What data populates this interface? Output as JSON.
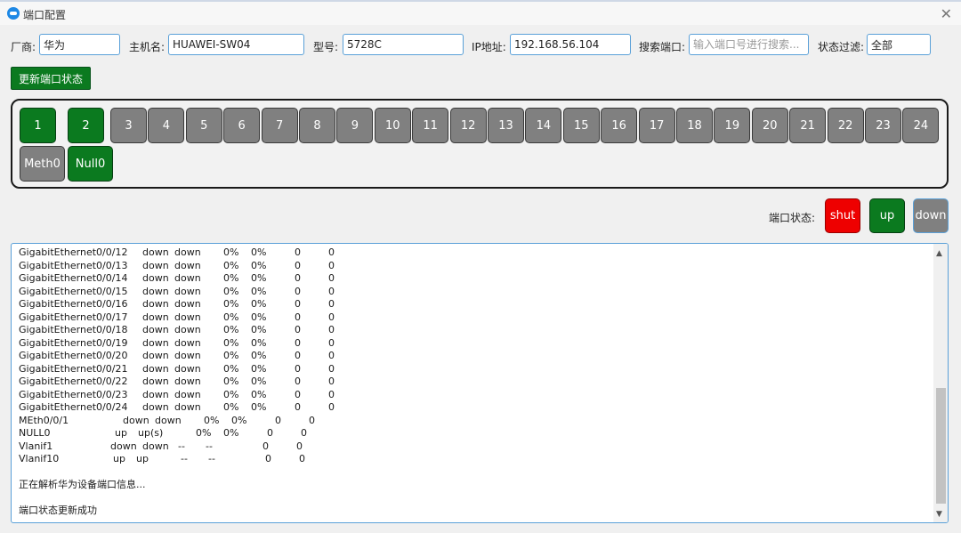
{
  "window": {
    "title": "端口配置"
  },
  "form": {
    "vendor_label": "厂商:",
    "vendor_value": "华为",
    "host_label": "主机名:",
    "host_value": "HUAWEI-SW04",
    "model_label": "型号:",
    "model_value": "5728C",
    "ip_label": "IP地址:",
    "ip_value": "192.168.56.104",
    "search_label": "搜索端口:",
    "search_placeholder": "输入端口号进行搜索...",
    "filter_label": "状态过滤:",
    "filter_value": "全部"
  },
  "refresh_label": "更新端口状态",
  "colors": {
    "up": "#0b7a1f",
    "down": "#808080",
    "shut": "#ee0000",
    "accent": "#5aa0d8"
  },
  "ports_row1": [
    {
      "label": "1",
      "status": "up"
    },
    {
      "label": "2",
      "status": "up"
    },
    {
      "label": "3",
      "status": "down"
    },
    {
      "label": "4",
      "status": "down"
    },
    {
      "label": "5",
      "status": "down"
    },
    {
      "label": "6",
      "status": "down"
    },
    {
      "label": "7",
      "status": "down"
    },
    {
      "label": "8",
      "status": "down"
    },
    {
      "label": "9",
      "status": "down"
    },
    {
      "label": "10",
      "status": "down"
    },
    {
      "label": "11",
      "status": "down"
    },
    {
      "label": "12",
      "status": "down"
    },
    {
      "label": "13",
      "status": "down"
    },
    {
      "label": "14",
      "status": "down"
    },
    {
      "label": "15",
      "status": "down"
    },
    {
      "label": "16",
      "status": "down"
    },
    {
      "label": "17",
      "status": "down"
    },
    {
      "label": "18",
      "status": "down"
    },
    {
      "label": "19",
      "status": "down"
    },
    {
      "label": "20",
      "status": "down"
    },
    {
      "label": "21",
      "status": "down"
    },
    {
      "label": "22",
      "status": "down"
    },
    {
      "label": "23",
      "status": "down"
    },
    {
      "label": "24",
      "status": "down"
    }
  ],
  "ports_row2": [
    {
      "label": "Meth0",
      "status": "down"
    },
    {
      "label": "Null0",
      "status": "up"
    }
  ],
  "legend": {
    "label": "端口状态:",
    "shut": "shut",
    "up": "up",
    "down": "down"
  },
  "console": {
    "rows": [
      {
        "iface": "GigabitEthernet0/0/12",
        "phy": "down",
        "proto": "down",
        "in": "0%",
        "out": "0%",
        "in_err": "0",
        "out_err": "0"
      },
      {
        "iface": "GigabitEthernet0/0/13",
        "phy": "down",
        "proto": "down",
        "in": "0%",
        "out": "0%",
        "in_err": "0",
        "out_err": "0"
      },
      {
        "iface": "GigabitEthernet0/0/14",
        "phy": "down",
        "proto": "down",
        "in": "0%",
        "out": "0%",
        "in_err": "0",
        "out_err": "0"
      },
      {
        "iface": "GigabitEthernet0/0/15",
        "phy": "down",
        "proto": "down",
        "in": "0%",
        "out": "0%",
        "in_err": "0",
        "out_err": "0"
      },
      {
        "iface": "GigabitEthernet0/0/16",
        "phy": "down",
        "proto": "down",
        "in": "0%",
        "out": "0%",
        "in_err": "0",
        "out_err": "0"
      },
      {
        "iface": "GigabitEthernet0/0/17",
        "phy": "down",
        "proto": "down",
        "in": "0%",
        "out": "0%",
        "in_err": "0",
        "out_err": "0"
      },
      {
        "iface": "GigabitEthernet0/0/18",
        "phy": "down",
        "proto": "down",
        "in": "0%",
        "out": "0%",
        "in_err": "0",
        "out_err": "0"
      },
      {
        "iface": "GigabitEthernet0/0/19",
        "phy": "down",
        "proto": "down",
        "in": "0%",
        "out": "0%",
        "in_err": "0",
        "out_err": "0"
      },
      {
        "iface": "GigabitEthernet0/0/20",
        "phy": "down",
        "proto": "down",
        "in": "0%",
        "out": "0%",
        "in_err": "0",
        "out_err": "0"
      },
      {
        "iface": "GigabitEthernet0/0/21",
        "phy": "down",
        "proto": "down",
        "in": "0%",
        "out": "0%",
        "in_err": "0",
        "out_err": "0"
      },
      {
        "iface": "GigabitEthernet0/0/22",
        "phy": "down",
        "proto": "down",
        "in": "0%",
        "out": "0%",
        "in_err": "0",
        "out_err": "0"
      },
      {
        "iface": "GigabitEthernet0/0/23",
        "phy": "down",
        "proto": "down",
        "in": "0%",
        "out": "0%",
        "in_err": "0",
        "out_err": "0"
      },
      {
        "iface": "GigabitEthernet0/0/24",
        "phy": "down",
        "proto": "down",
        "in": "0%",
        "out": "0%",
        "in_err": "0",
        "out_err": "0"
      },
      {
        "iface": "MEth0/0/1",
        "phy": "down",
        "proto": "down",
        "in": "0%",
        "out": "0%",
        "in_err": "0",
        "out_err": "0"
      },
      {
        "iface": "NULL0",
        "phy": "up",
        "proto": "up(s)",
        "in": "0%",
        "out": "0%",
        "in_err": "0",
        "out_err": "0"
      },
      {
        "iface": "Vlanif1",
        "phy": "down",
        "proto": "down",
        "in": "--",
        "out": "--",
        "in_err": "0",
        "out_err": "0"
      },
      {
        "iface": "Vlanif10",
        "phy": "up",
        "proto": "up",
        "in": "--",
        "out": "--",
        "in_err": "0",
        "out_err": "0"
      }
    ],
    "message_parsing": "正在解析华为设备端口信息...",
    "message_success": "端口状态更新成功"
  }
}
